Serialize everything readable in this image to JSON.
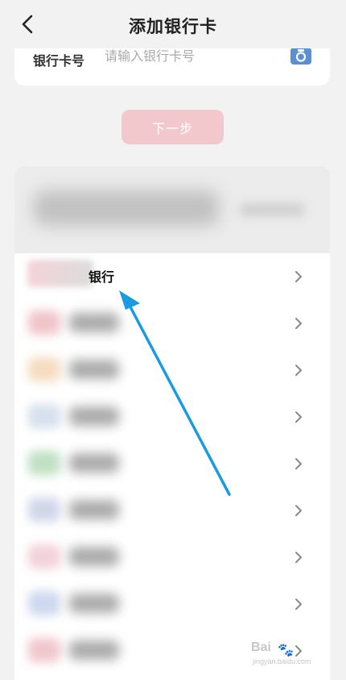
{
  "header": {
    "title": "添加银行卡",
    "back_icon": "chevron-left-icon"
  },
  "card_input": {
    "label": "银行卡号",
    "value": "",
    "placeholder": "请输入银行卡号",
    "camera_icon": "camera-icon"
  },
  "next_button": {
    "label": "下一步",
    "color": "#f3c8cc"
  },
  "bank_list": {
    "items": [
      {
        "name": "银行",
        "logo_color": "#f4d3d8"
      },
      {
        "name": "",
        "logo_color": "#f0c4c8"
      },
      {
        "name": "",
        "logo_color": "#f6dcc0"
      },
      {
        "name": "",
        "logo_color": "#d6e0ee"
      },
      {
        "name": "",
        "logo_color": "#bfe0c4"
      },
      {
        "name": "",
        "logo_color": "#d2d6ea"
      },
      {
        "name": "",
        "logo_color": "#f2d2da"
      },
      {
        "name": "",
        "logo_color": "#cdd8ee"
      },
      {
        "name": "",
        "logo_color": "#f1c7cc"
      }
    ],
    "chevron_icon": "chevron-right-icon"
  },
  "annotation": {
    "arrow_color": "#1a9be0"
  },
  "watermark": {
    "logo_text": "Bai",
    "url": "jingyan.baidu.com"
  }
}
